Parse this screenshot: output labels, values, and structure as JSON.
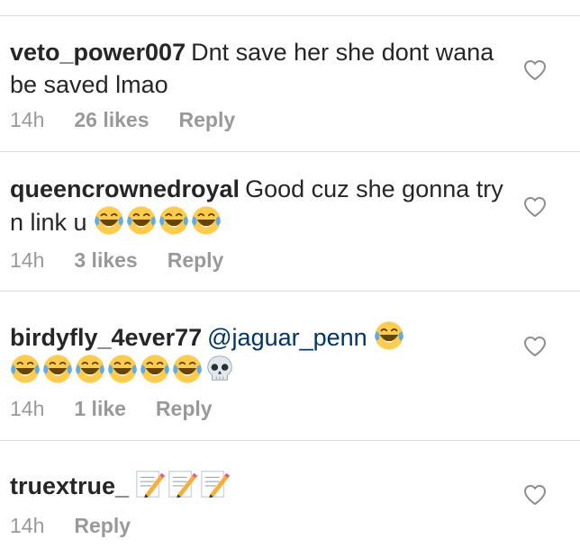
{
  "comments": [
    {
      "username": "veto_power007",
      "text": "Dnt save her she dont wana be saved lmao",
      "time": "14h",
      "likes": "26 likes",
      "reply": "Reply"
    },
    {
      "username": "queencrownedroyal",
      "text": "Good cuz she gonna try n link u",
      "emojis": [
        "laughing-crying",
        "laughing-crying",
        "laughing-crying",
        "laughing-crying"
      ],
      "time": "14h",
      "likes": "3 likes",
      "reply": "Reply"
    },
    {
      "username": "birdyfly_4ever77",
      "mention": "@jaguar_penn",
      "emojis": [
        "laughing-crying",
        "laughing-crying",
        "laughing-crying",
        "laughing-crying",
        "laughing-crying",
        "laughing-crying",
        "laughing-crying",
        "skull"
      ],
      "time": "14h",
      "likes": "1 like",
      "reply": "Reply"
    },
    {
      "username": "truextrue_",
      "emojis": [
        "memo",
        "memo",
        "memo"
      ],
      "time": "14h",
      "reply": "Reply"
    }
  ],
  "icons": {
    "like": "heart-outline-icon"
  },
  "colors": {
    "text": "#262626",
    "meta": "#999999",
    "mention": "#003569",
    "divider": "#dbdbdb",
    "emoji_face": "#ffcc4d",
    "emoji_tear": "#5dadec"
  }
}
